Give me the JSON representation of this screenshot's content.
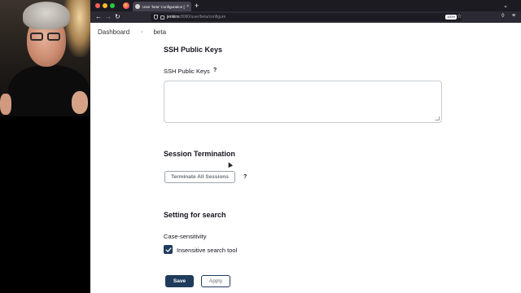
{
  "browser": {
    "tab_title": "User 'beta' Configuration [Jenkins]",
    "tab_close": "×",
    "new_tab": "+",
    "url_host": "jenkins",
    "url_rest": ":8080/user/beta/configure",
    "zoom": "100%"
  },
  "breadcrumb": {
    "items": [
      "Dashboard",
      "beta"
    ],
    "separator": "›"
  },
  "ssh": {
    "heading": "SSH Public Keys",
    "field_label": "SSH Public Keys",
    "help": "?",
    "value": ""
  },
  "session": {
    "heading": "Session Termination",
    "button_label": "Terminate All Sessions",
    "help": "?"
  },
  "search": {
    "heading": "Setting for search",
    "field_label": "Case-sensitivity",
    "checkbox_label": "Insensitive search tool",
    "checked": true
  },
  "actions": {
    "save_label": "Save",
    "apply_label": "Apply"
  },
  "colors": {
    "primary": "#1f3b5c",
    "browser_dark": "#1c1b22"
  }
}
